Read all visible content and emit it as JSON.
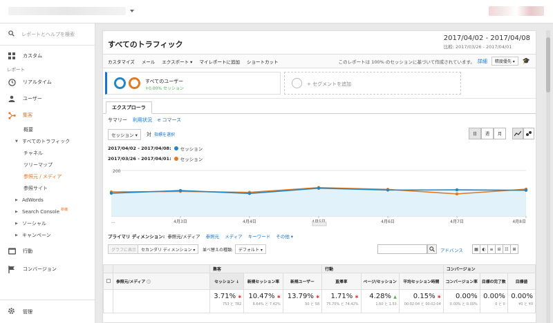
{
  "topbar": {},
  "sidebar": {
    "search_placeholder": "レポートとヘルプを検索",
    "custom": "カスタム",
    "report_section": "レポート",
    "realtime": "リアルタイム",
    "users": "ユーザー",
    "acquisition": "集客",
    "overview": "概要",
    "all_traffic": "すべてのトラフィック",
    "channels": "チャネル",
    "treemap": "ツリーマップ",
    "source_medium": "参照元 / メディア",
    "referrals": "参照サイト",
    "adwords": "AdWords",
    "search_console": "Search Console",
    "new_tag": "新機",
    "social": "ソーシャル",
    "campaigns": "キャンペーン",
    "behavior": "行動",
    "conversions": "コンバージョン",
    "admin": "管理"
  },
  "header": {
    "title": "すべてのトラフィック",
    "date_range": "2017/04/02 - 2017/04/08",
    "compare_range": "比較: 2017/03/26 - 2017/04/01"
  },
  "toolbar": {
    "customize": "カスタマイズ",
    "email": "メール",
    "export": "エクスポート ▾",
    "add_dashboard": "マイレポートに追加",
    "shortcut": "ショートカット",
    "note": "このレポートは 100% のセッションに基づいて作成されています。",
    "detail": "詳細",
    "precision": "精度優先 ▾"
  },
  "segments": {
    "all_users": "すべてのユーザー",
    "pct": "+0.00% セッション",
    "add_segment": "+ セグメントを追加"
  },
  "tabs": {
    "explorer": "エクスプローラ",
    "summary": "サマリー",
    "usage": "利用状況",
    "ecommerce": "e コマース"
  },
  "controls": {
    "metric": "セッション ▾",
    "vs": "対",
    "pick_metric": "指標を選択",
    "day": "日",
    "week": "週",
    "month": "月"
  },
  "legend": {
    "current_label": "2017/04/02 - 2017/04/08:",
    "previous_label": "2017/03/26 - 2017/04/01:",
    "metric": "セッション"
  },
  "colors": {
    "current": "#2485c4",
    "previous": "#e07b24",
    "accent": "#e8711c",
    "link": "#1a73c8"
  },
  "chart_data": {
    "type": "line",
    "x": [
      "...",
      "4月3日",
      "4月4日",
      "4月5日",
      "4月6日",
      "4月7日",
      "4月8日"
    ],
    "ytick": "200",
    "ylim": [
      0,
      200
    ],
    "series": [
      {
        "name": "2017/04/02 - 2017/04/08",
        "values": [
          100,
          112,
          99,
          122,
          114,
          115,
          113
        ]
      },
      {
        "name": "2017/03/26 - 2017/04/01",
        "values": [
          106,
          108,
          104,
          125,
          117,
          97,
          118
        ]
      }
    ]
  },
  "dimension": {
    "label": "プライマリ ディメンション:",
    "current": "参照元/メディア",
    "source": "参照元",
    "medium": "メディア",
    "keyword": "キーワード",
    "other": "その他 ▾"
  },
  "table_controls": {
    "plot_rows": "グラフに表示",
    "secondary": "セカンダリ ディメンション ▾",
    "sort_type": "並べ替えの種類:",
    "default": "デフォルト ▾",
    "advanced": "アドバンス"
  },
  "table": {
    "groups": [
      "集客",
      "行動",
      "コンバージョン"
    ],
    "dim_header": "参照元/メディア",
    "columns": [
      "セッション",
      "新規セッション率",
      "新規ユーザー",
      "直帰率",
      "ページ/セッション",
      "平均セッション時間",
      "コンバージョン率",
      "目標の完了数",
      "目標値"
    ],
    "totals": [
      {
        "value": "3.71%",
        "sub": "753 と 782"
      },
      {
        "value": "10.47%",
        "sub": "6.64% と 7.42%"
      },
      {
        "value": "13.79%",
        "sub": "50 と 58"
      },
      {
        "value": "1.71%",
        "sub": "75.70% と 74.42%"
      },
      {
        "value": "4.28%",
        "sub": "1.60 と 1.53"
      },
      {
        "value": "0.15%",
        "sub": "00:02:04 と 00:02:04"
      },
      {
        "value": "0.00%",
        "sub": "0.00% と 0.00%"
      },
      {
        "value": "0.00%",
        "sub": "0 と 0"
      },
      {
        "value": "0.00%",
        "sub": "¥0 と ¥0"
      }
    ]
  }
}
